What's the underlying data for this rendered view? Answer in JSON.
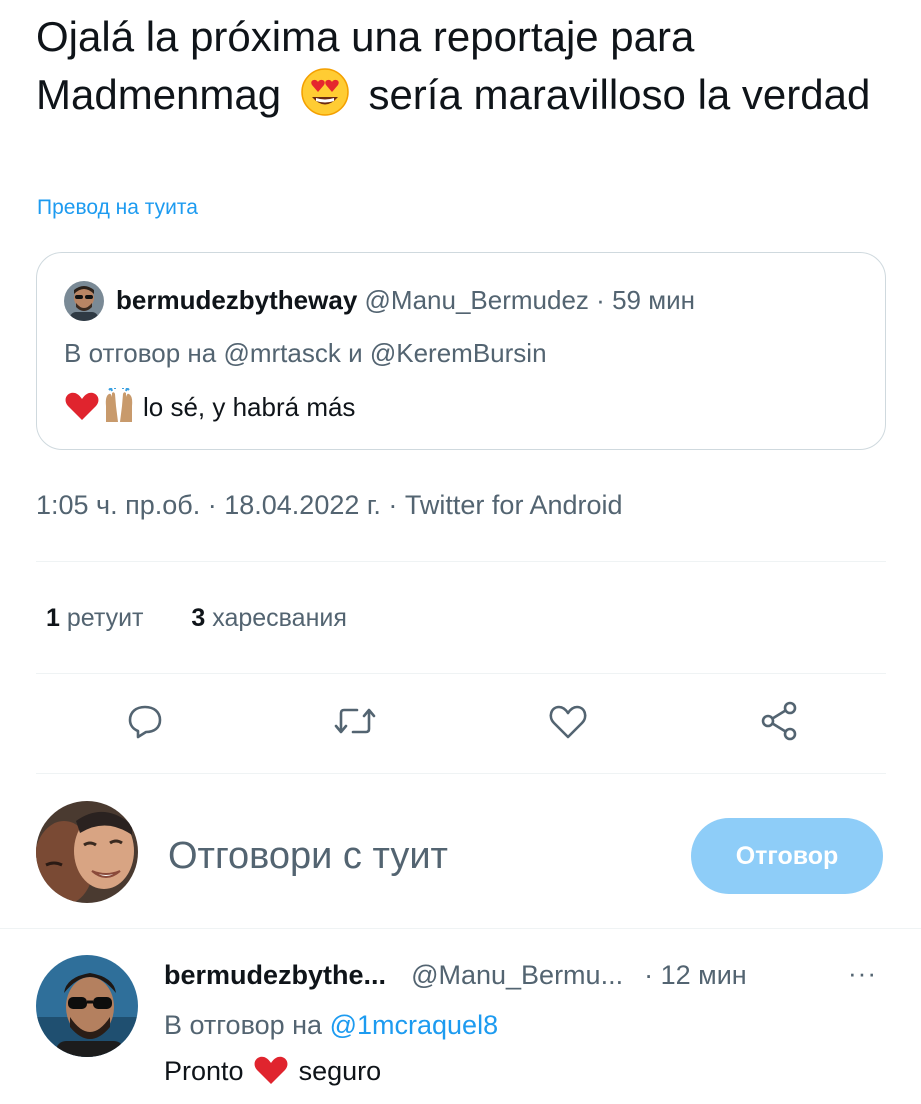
{
  "tweet": {
    "text_part1": "Ojalá la próxima una reportaje para Madmenmag",
    "text_part2": "sería maravilloso la verdad",
    "emoji_icon": "heart-eyes-emoji",
    "translate_link": "Превод на туита"
  },
  "quote": {
    "display_name": "bermudezbytheway",
    "handle": "@Manu_Bermudez",
    "separator": "·",
    "time": "59 мин",
    "reply_prefix": "В отговор на",
    "reply_mention_1": "@mrtasck",
    "reply_conjunction": "и",
    "reply_mention_2": "@KeremBursin",
    "body": "lo sé, y habrá más",
    "emoji_icons": [
      "red-heart-emoji",
      "raising-hands-emoji"
    ]
  },
  "meta": {
    "timestamp": "1:05 ч. пр.об. · 18.04.2022 г. · Twitter for Android"
  },
  "stats": {
    "retweets_count": "1",
    "retweets_label": "ретуит",
    "likes_count": "3",
    "likes_label": "харесвания"
  },
  "actions": [
    "reply-icon",
    "retweet-icon",
    "like-icon",
    "share-icon"
  ],
  "composer": {
    "placeholder": "Отговори с туит",
    "button_label": "Отговор"
  },
  "reply": {
    "display_name": "bermudezbythe...",
    "handle": "@Manu_Bermu...",
    "separator": "·",
    "time": "12 мин",
    "more": "···",
    "reply_prefix": "В отговор на",
    "reply_mention": "@1mcraquel8",
    "body_part1": "Pronto",
    "body_part2": "seguro",
    "emoji_icon": "red-heart-emoji"
  },
  "colors": {
    "accent": "#1d9bf0",
    "button_disabled": "#8ecdf8",
    "text_primary": "#0f1419",
    "text_secondary": "#536471",
    "border": "#cfd9de"
  }
}
